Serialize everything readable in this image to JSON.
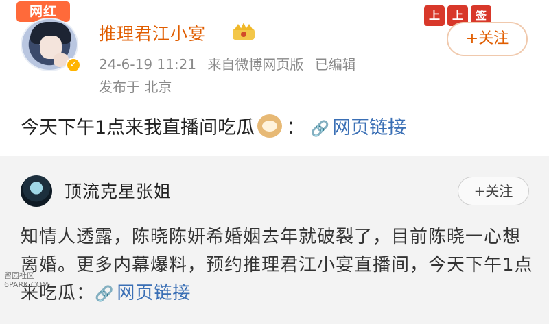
{
  "post": {
    "badge": "网红",
    "author": "推理君江小宴",
    "timestamp": "24-6-19 11:21",
    "source": "来自微博网页版",
    "edited": "已编辑",
    "location": "发布于 北京",
    "follow_label": "+关注",
    "text": "今天下午1点来我直播间吃瓜",
    "colon": "：",
    "link_label": "网页链接",
    "deco_labels": [
      "上",
      "上",
      "签"
    ]
  },
  "repost": {
    "author": "顶流克星张姐",
    "follow_label": "+关注",
    "text": "知情人透露，陈晓陈妍希婚姻去年就破裂了，目前陈晓一心想离婚。更多内幕爆料，预约推理君江小宴直播间，今天下午1点来吃瓜：",
    "link_label": "网页链接"
  },
  "watermark": {
    "line1": "留园社区",
    "line2": "6PARK.COM"
  },
  "colors": {
    "author": "#e05d00",
    "link": "#3a6fb5",
    "badge": "#ff6a3a",
    "repost_bg": "#f3f3f3"
  }
}
